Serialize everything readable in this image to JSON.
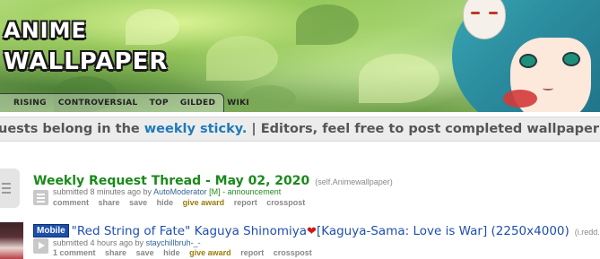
{
  "banner": {
    "title_line1": "ANIME",
    "title_line2": "WALLPAPER"
  },
  "tabs": [
    "RISING",
    "CONTROVERSIAL",
    "TOP",
    "GILDED",
    "WIKI"
  ],
  "announcement": {
    "text_before": "uests belong in the ",
    "link": "weekly sticky.",
    "text_after": " | Editors, feel free to post completed wallpaper requests as p"
  },
  "posts": [
    {
      "title": "Weekly Request Thread - May 02, 2020",
      "domain": "(self.Animewallpaper)",
      "submitted": "submitted 8 minutes ago by",
      "author": "AutoModerator",
      "mod_tag": "[M]",
      "distinguished": "- announcement",
      "buttons": [
        "comment",
        "share",
        "save",
        "hide",
        "give award",
        "report",
        "crosspost"
      ]
    },
    {
      "flair": "Mobile",
      "title_part1": "\"Red String of Fate\" Kaguya Shinomiya",
      "heart": "❤",
      "title_part2": "[Kaguya-Sama: Love is War] (2250x4000)",
      "domain": "(i.redd.it)",
      "submitted": "submitted 4 hours ago by",
      "author": "staychillbruh-_-",
      "buttons": [
        "1 comment",
        "share",
        "save",
        "hide",
        "give award",
        "report",
        "crosspost"
      ]
    }
  ],
  "colors": {
    "title_green": "#1a8a1a",
    "link_blue": "#1f7ab8",
    "flair_bg": "#1d4ea8",
    "give_award": "#9a7d0a"
  }
}
